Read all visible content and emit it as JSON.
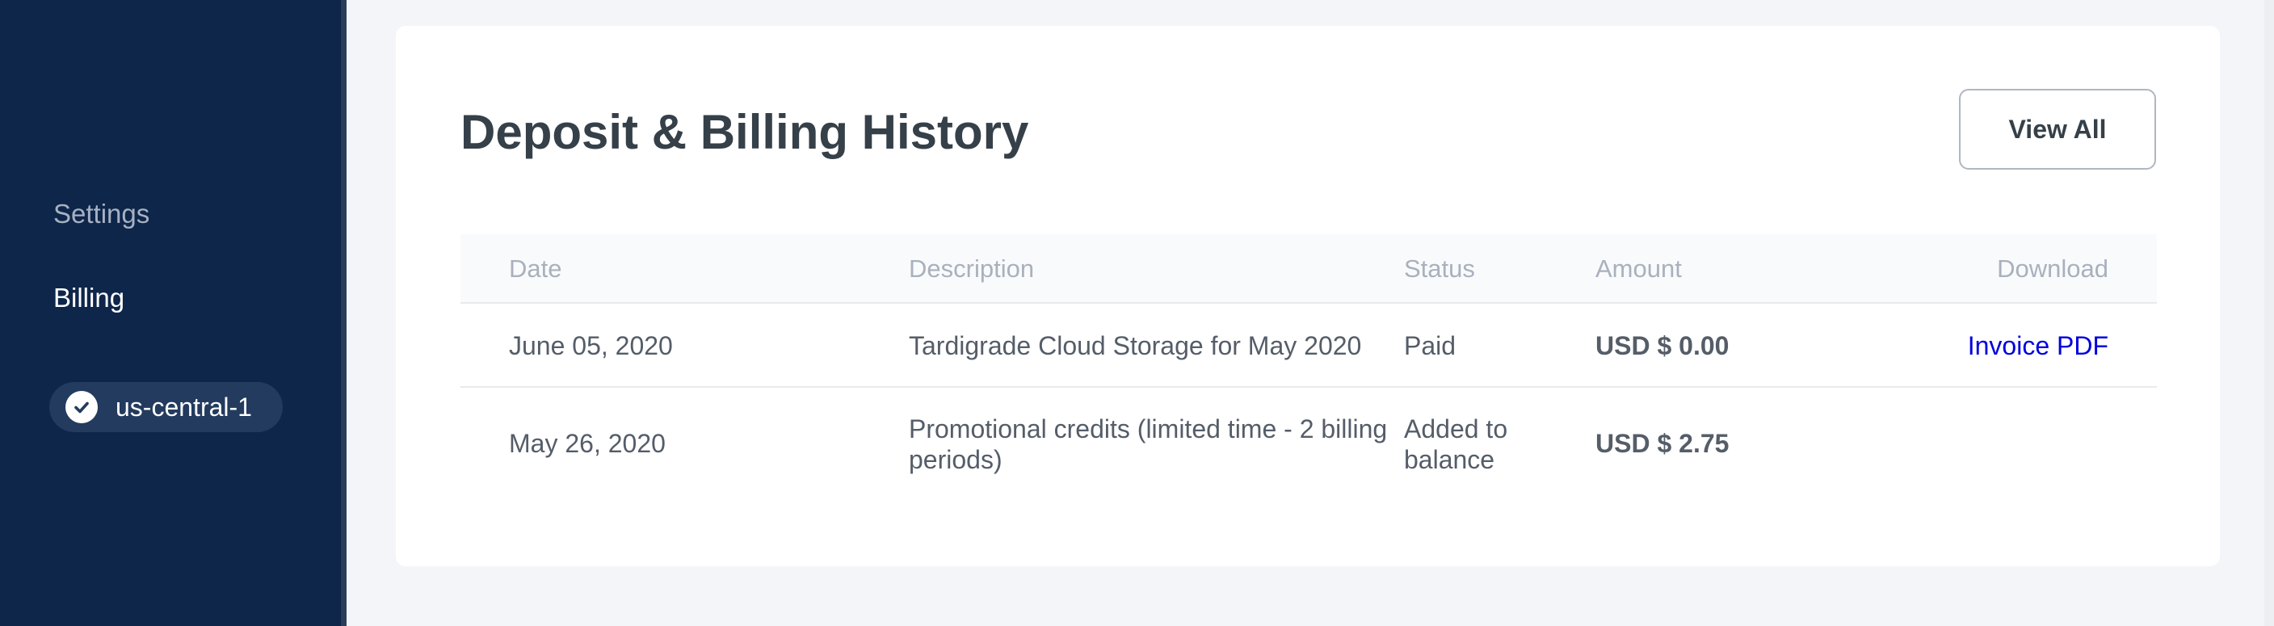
{
  "sidebar": {
    "items": [
      {
        "label": "Settings"
      },
      {
        "label": "Billing"
      }
    ],
    "project": {
      "name": "us-central-1",
      "icon": "check-circle-icon"
    }
  },
  "card": {
    "title": "Deposit & Billing History",
    "view_all_label": "View All"
  },
  "table": {
    "headers": {
      "date": "Date",
      "description": "Description",
      "status": "Status",
      "amount": "Amount",
      "download": "Download"
    },
    "rows": [
      {
        "date": "June 05, 2020",
        "description": "Tardigrade Cloud Storage for May 2020",
        "status": "Paid",
        "amount": "USD $ 0.00",
        "download": "Invoice PDF"
      },
      {
        "date": "May 26, 2020",
        "description": "Promotional credits (limited time - 2 billing periods)",
        "status": "Added to balance",
        "amount": "USD $ 2.75",
        "download": ""
      }
    ]
  },
  "colors": {
    "sidebar_bg": "#0e264a",
    "link": "#0000e0",
    "title_text": "#354049"
  }
}
